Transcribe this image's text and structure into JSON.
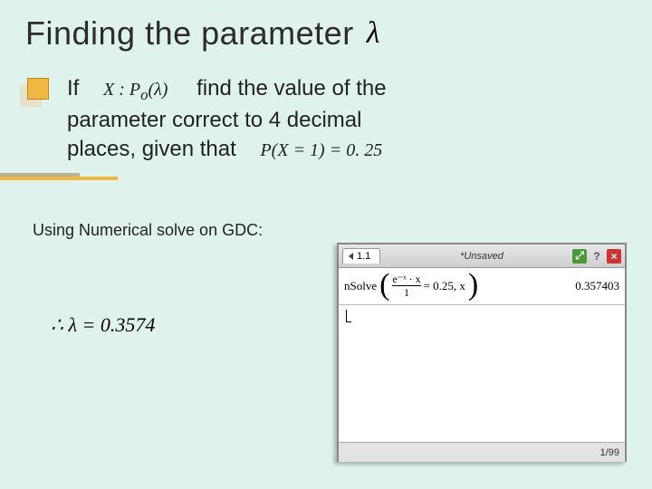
{
  "title": "Finding the parameter",
  "lambda_symbol": "λ",
  "body": {
    "if": "If",
    "dist": "X :  P",
    "dist_sub": "o",
    "dist_arg": "(λ)",
    "line1_rest": "find the value of the",
    "line2": "parameter correct to 4 decimal",
    "line3a": "places, given that",
    "prob_expr": "P(X = 1) = 0. 25"
  },
  "subhead": "Using Numerical solve on GDC:",
  "result": "∴ λ = 0.3574",
  "calc": {
    "tab": "1.1",
    "doc_title": "*Unsaved",
    "nsolve_label": "nSolve",
    "frac_num": "e⁻ˣ · x",
    "frac_den": "1",
    "eq_rhs": "= 0.25, x",
    "answer": "0.357403",
    "page_counter": "1/99",
    "help": "?",
    "close": "×",
    "expand": "⤢"
  }
}
